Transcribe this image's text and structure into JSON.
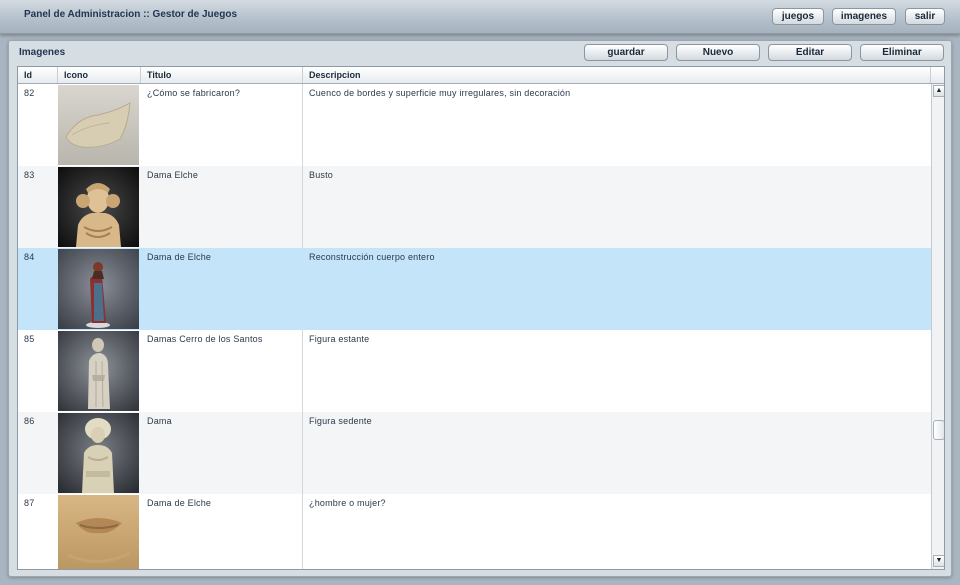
{
  "header": {
    "title": "Panel de Administracion :: Gestor de Juegos",
    "nav": [
      "juegos",
      "imagenes",
      "salir"
    ]
  },
  "panel": {
    "title": "Imagenes",
    "actions": [
      "guardar",
      "Nuevo",
      "Editar",
      "Eliminar"
    ]
  },
  "table": {
    "columns": [
      "Id",
      "Icono",
      "Titulo",
      "Descripcion"
    ],
    "rows": [
      {
        "id": "82",
        "icon": "stone-fragment-thumbnail",
        "titulo": "¿Cómo se fabricaron?",
        "descripcion": "Cuenco de bordes y superficie muy irregulares, sin decoración"
      },
      {
        "id": "83",
        "icon": "dama-bust-thumbnail",
        "titulo": "Dama Elche",
        "descripcion": "Busto"
      },
      {
        "id": "84",
        "icon": "painted-figure-thumbnail",
        "titulo": "Dama de Elche",
        "descripcion": "Reconstrucción cuerpo entero"
      },
      {
        "id": "85",
        "icon": "standing-figure-thumbnail",
        "titulo": "Damas Cerro de los Santos",
        "descripcion": "Figura estante"
      },
      {
        "id": "86",
        "icon": "seated-figure-thumbnail",
        "titulo": "Dama",
        "descripcion": "Figura sedente"
      },
      {
        "id": "87",
        "icon": "face-closeup-thumbnail",
        "titulo": "Dama de Elche",
        "descripcion": "¿hombre o mujer?"
      }
    ],
    "selected_id": "84"
  },
  "colors": {
    "selected_row": "#c3e4f9",
    "header_text": "#1f3550"
  }
}
